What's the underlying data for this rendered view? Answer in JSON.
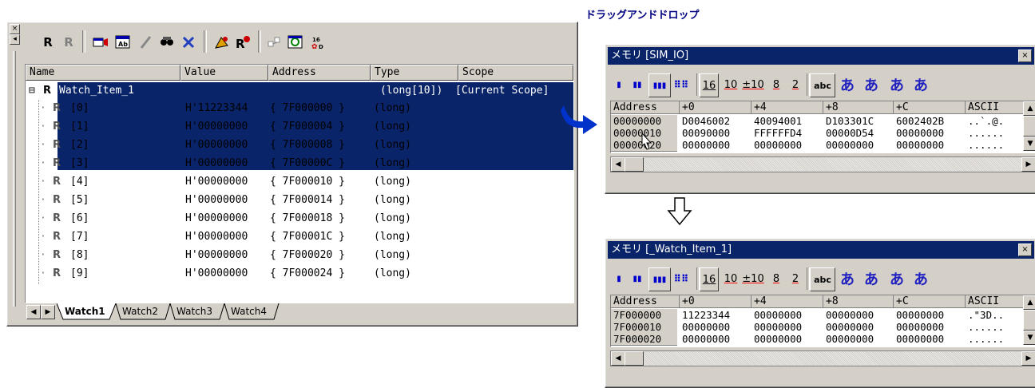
{
  "caption": "ドラッグアンドドロップ",
  "watch": {
    "toolbar": [
      "R",
      "R"
    ],
    "columns": [
      "Name",
      "Value",
      "Address",
      "Type",
      "Scope"
    ],
    "parent": {
      "name": "Watch_Item_1",
      "type": "(long[10])",
      "scope": "[Current Scope]"
    },
    "rows": [
      {
        "name": "[0]",
        "value": "H'11223344",
        "address": "{ 7F000000 }",
        "type": "(long)"
      },
      {
        "name": "[1]",
        "value": "H'00000000",
        "address": "{ 7F000004 }",
        "type": "(long)"
      },
      {
        "name": "[2]",
        "value": "H'00000000",
        "address": "{ 7F000008 }",
        "type": "(long)"
      },
      {
        "name": "[3]",
        "value": "H'00000000",
        "address": "{ 7F00000C }",
        "type": "(long)"
      },
      {
        "name": "[4]",
        "value": "H'00000000",
        "address": "{ 7F000010 }",
        "type": "(long)"
      },
      {
        "name": "[5]",
        "value": "H'00000000",
        "address": "{ 7F000014 }",
        "type": "(long)"
      },
      {
        "name": "[6]",
        "value": "H'00000000",
        "address": "{ 7F000018 }",
        "type": "(long)"
      },
      {
        "name": "[7]",
        "value": "H'00000000",
        "address": "{ 7F00001C }",
        "type": "(long)"
      },
      {
        "name": "[8]",
        "value": "H'00000000",
        "address": "{ 7F000020 }",
        "type": "(long)"
      },
      {
        "name": "[9]",
        "value": "H'00000000",
        "address": "{ 7F000024 }",
        "type": "(long)"
      }
    ],
    "tabs": [
      "Watch1",
      "Watch2",
      "Watch3",
      "Watch4"
    ]
  },
  "memory_top": {
    "title": "メモリ [SIM_IO]",
    "toolbar": [
      "16",
      "10",
      "±10",
      "8",
      "2",
      "abc",
      "あ",
      "あ",
      "あ",
      "あ"
    ],
    "columns": [
      "Address",
      "+0",
      "+4",
      "+8",
      "+C",
      "ASCII"
    ],
    "rows": [
      [
        "00000000",
        "D0046002",
        "40094001",
        "D103301C",
        "6002402B",
        "..`.@."
      ],
      [
        "00000010",
        "00090000",
        "FFFFFFD4",
        "00000D54",
        "00000000",
        "......"
      ],
      [
        "00000020",
        "00000000",
        "00000000",
        "00000000",
        "00000000",
        "......"
      ]
    ]
  },
  "memory_bottom": {
    "title": "メモリ [_Watch_Item_1]",
    "toolbar": [
      "16",
      "10",
      "±10",
      "8",
      "2",
      "abc",
      "あ",
      "あ",
      "あ",
      "あ"
    ],
    "columns": [
      "Address",
      "+0",
      "+4",
      "+8",
      "+C",
      "ASCII"
    ],
    "rows": [
      [
        "7F000000",
        "11223344",
        "00000000",
        "00000000",
        "00000000",
        ".\"3D.."
      ],
      [
        "7F000010",
        "00000000",
        "00000000",
        "00000000",
        "00000000",
        "......"
      ],
      [
        "7F000020",
        "00000000",
        "00000000",
        "00000000",
        "00000000",
        "......"
      ]
    ]
  },
  "colors": {
    "selection": "#0a246a",
    "arrow": "#0033cc",
    "toolbar_blue": "#0000cc"
  }
}
